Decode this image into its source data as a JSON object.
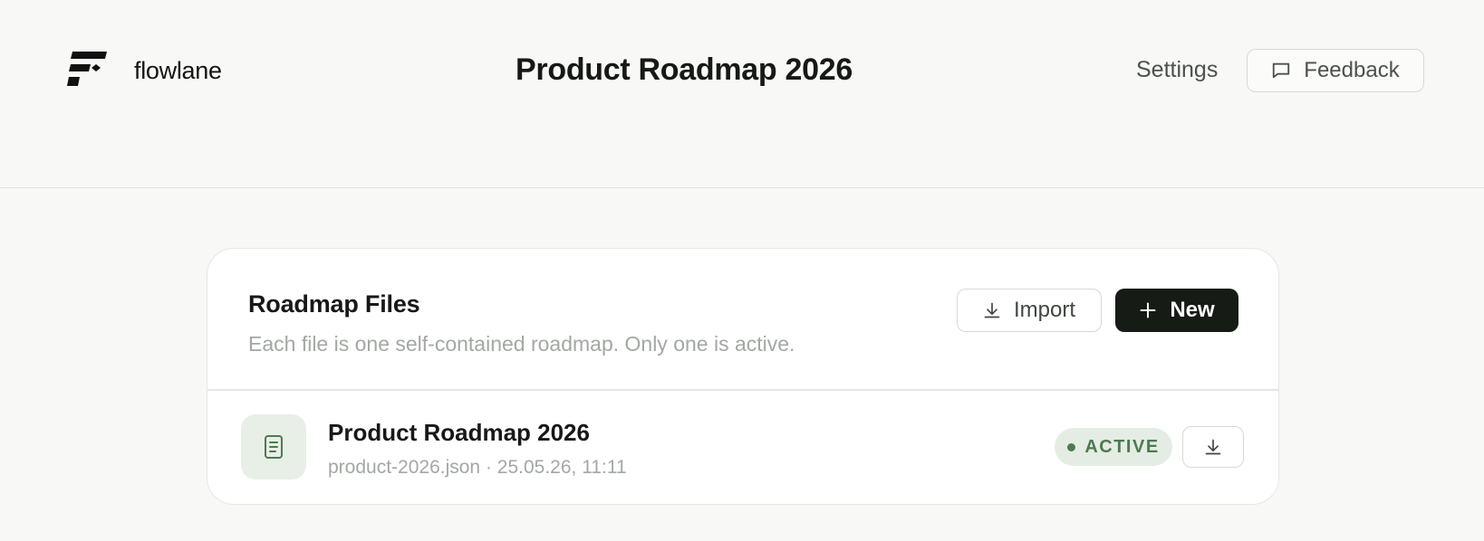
{
  "app": {
    "brand_name": "flowlane",
    "page_title": "Product Roadmap 2026"
  },
  "nav": {
    "settings_label": "Settings",
    "feedback_label": "Feedback"
  },
  "files_panel": {
    "title": "Roadmap Files",
    "subtitle": "Each file is one self-contained roadmap. Only one is active.",
    "import_label": "Import",
    "new_label": "New",
    "files": [
      {
        "name": "Product Roadmap 2026",
        "meta": "product-2026.json · 25.05.26, 11:11",
        "status": "ACTIVE"
      }
    ]
  },
  "icons": {
    "logo": "flowlane-logo-icon",
    "feedback": "message-square-icon",
    "import": "download-icon",
    "new": "plus-icon",
    "file": "file-text-icon",
    "download": "download-icon"
  },
  "colors": {
    "primary_button": "#161b16",
    "active_badge_bg": "#e4ede3",
    "active_badge_text": "#4d7a4f",
    "file_icon_bg": "#e7efe6",
    "background": "#f8f8f7"
  }
}
